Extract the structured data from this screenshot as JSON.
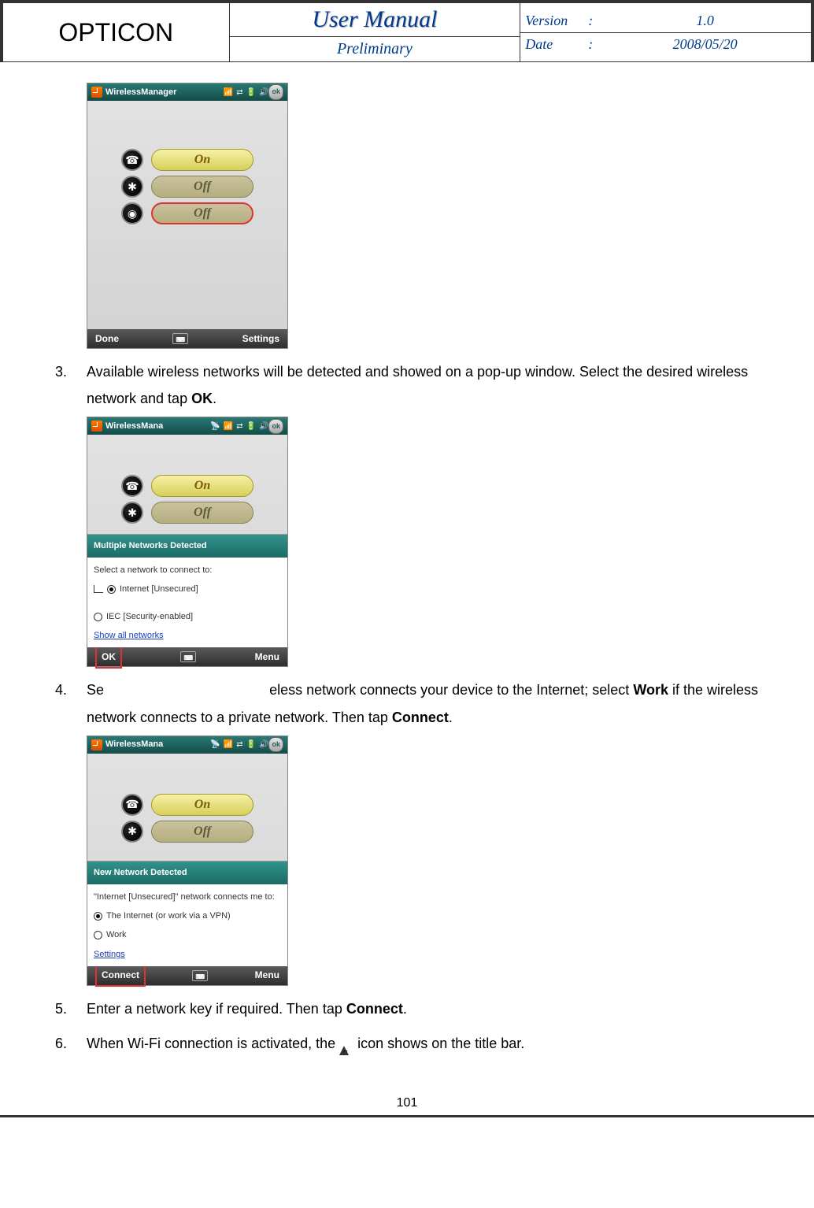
{
  "header": {
    "brand": "OPTICON",
    "title": "User Manual",
    "subtitle": "Preliminary",
    "version_label": "Version",
    "version_value": "1.0",
    "date_label": "Date",
    "date_value": "2008/05/20"
  },
  "screenshots": {
    "s1": {
      "title": "WirelessManager",
      "ok": "ok",
      "phone_state": "On",
      "bt_state": "Off",
      "wifi_state": "Off",
      "bottom_left": "Done",
      "bottom_right": "Settings"
    },
    "s2": {
      "title": "WirelessMana",
      "ok": "ok",
      "phone_state": "On",
      "bt_state": "Off",
      "popup_title": "Multiple Networks Detected",
      "popup_prompt": "Select a network to connect to:",
      "opt1": "Internet [Unsecured]",
      "opt2": "IEC [Security-enabled]",
      "link": "Show all networks",
      "bottom_left": "OK",
      "bottom_right": "Menu"
    },
    "s3": {
      "title": "WirelessMana",
      "ok": "ok",
      "phone_state": "On",
      "bt_state": "Off",
      "popup_title": "New Network Detected",
      "popup_prompt": "\"Internet [Unsecured]\" network connects me to:",
      "opt1": "The Internet (or work via a VPN)",
      "opt2": "Work",
      "link": "Settings",
      "bottom_left": "Connect",
      "bottom_right": "Menu"
    }
  },
  "steps": {
    "n3": "3.",
    "t3a": "Available wireless networks will be detected and showed on a pop-up window. Select the desired wireless network and tap ",
    "t3b": "OK",
    "t3c": ".",
    "n4": "4.",
    "t4a": "Se",
    "t4b": "eless network connects your device to the Internet; select ",
    "t4c": "Work",
    "t4d": " if the wireless network connects to a private network. Then tap ",
    "t4e": "Connect",
    "t4f": ".",
    "n5": "5.",
    "t5a": "Enter a network key if required. Then tap ",
    "t5b": "Connect",
    "t5c": ".",
    "n6": "6.",
    "t6a": "When Wi-Fi connection is activated, the ",
    "t6b": " icon shows on the title bar."
  },
  "page_number": "101"
}
